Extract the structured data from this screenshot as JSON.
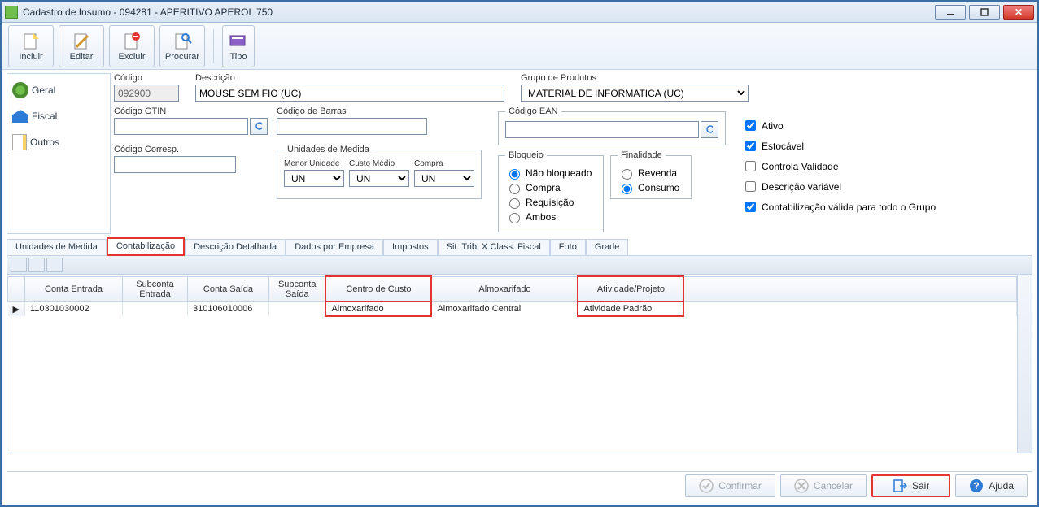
{
  "window": {
    "title": "Cadastro de Insumo - 094281 - APERITIVO APEROL 750"
  },
  "toolbar": {
    "incluir": "Incluir",
    "editar": "Editar",
    "excluir": "Excluir",
    "procurar": "Procurar",
    "tipo": "Tipo"
  },
  "sidebar": {
    "geral": "Geral",
    "fiscal": "Fiscal",
    "outros": "Outros"
  },
  "form": {
    "codigo_lbl": "Código",
    "codigo_val": "092900",
    "descricao_lbl": "Descrição",
    "descricao_val": "MOUSE SEM FIO (UC)",
    "grupo_lbl": "Grupo de Produtos",
    "grupo_val": "MATERIAL DE INFORMATICA (UC)",
    "gtin_lbl": "Código GTIN",
    "barras_lbl": "Código de Barras",
    "ean_lbl": "Código EAN",
    "corresp_lbl": "Código Corresp.",
    "umgroup_lbl": "Unidades de Medida",
    "menor_lbl": "Menor Unidade",
    "custo_lbl": "Custo Médio",
    "compra_lbl": "Compra",
    "um1": "UN",
    "um2": "UN",
    "um3": "UN",
    "bloqueio_lbl": "Bloqueio",
    "bloq_nao": "Não bloqueado",
    "bloq_compra": "Compra",
    "bloq_req": "Requisição",
    "bloq_ambos": "Ambos",
    "finalidade_lbl": "Finalidade",
    "fin_revenda": "Revenda",
    "fin_consumo": "Consumo",
    "chk_ativo": "Ativo",
    "chk_estocavel": "Estocável",
    "chk_validade": "Controla Validade",
    "chk_descvar": "Descrição variável",
    "chk_contgrupo": "Contabilização válida para todo o Grupo"
  },
  "tabs": {
    "um": "Unidades de Medida",
    "cont": "Contabilização",
    "desc": "Descrição Detalhada",
    "dados": "Dados por Empresa",
    "imp": "Impostos",
    "sit": "Sit. Trib. X Class. Fiscal",
    "foto": "Foto",
    "grade": "Grade"
  },
  "grid": {
    "cols": {
      "conta_ent": "Conta Entrada",
      "sub_ent": "Subconta Entrada",
      "conta_sai": "Conta Saída",
      "sub_sai": "Subconta Saída",
      "centro": "Centro de Custo",
      "almox": "Almoxarifado",
      "ativ": "Atividade/Projeto"
    },
    "row": {
      "conta_ent": "110301030002",
      "sub_ent": "",
      "conta_sai": "310106010006",
      "sub_sai": "",
      "centro": "Almoxarifado",
      "almox": "Almoxarifado Central",
      "ativ": "Atividade Padrão"
    }
  },
  "footer": {
    "confirmar": "Confirmar",
    "cancelar": "Cancelar",
    "sair": "Sair",
    "ajuda": "Ajuda"
  }
}
